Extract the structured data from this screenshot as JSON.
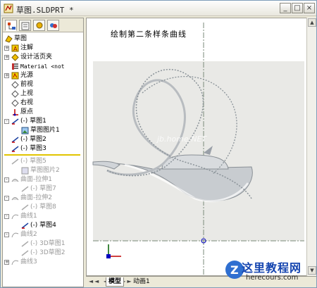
{
  "window": {
    "title": "草图.SLDPRT *",
    "buttons": {
      "minimize": "_",
      "maximize": "□",
      "close": "×"
    }
  },
  "panel_tabs": [
    "feature-manager",
    "property-manager",
    "configuration-manager",
    "display-manager"
  ],
  "tree": {
    "root": "草图",
    "items": [
      {
        "label": "注解",
        "icon": "annotation-icon",
        "greyed": false
      },
      {
        "label": "设计活页夹",
        "icon": "design-binder-icon",
        "greyed": false
      },
      {
        "label": "Material <not",
        "icon": "material-icon",
        "greyed": false
      },
      {
        "label": "光源",
        "icon": "light-icon",
        "greyed": false
      },
      {
        "label": "前视",
        "icon": "plane-icon",
        "greyed": false
      },
      {
        "label": "上视",
        "icon": "plane-icon",
        "greyed": false
      },
      {
        "label": "右视",
        "icon": "plane-icon",
        "greyed": false
      },
      {
        "label": "原点",
        "icon": "origin-icon",
        "greyed": false
      },
      {
        "label": "(-) 草图1",
        "icon": "sketch-icon",
        "greyed": false
      },
      {
        "label": "草图图片1",
        "icon": "sketch-picture-icon",
        "greyed": false
      },
      {
        "label": "(-) 草图2",
        "icon": "sketch-icon",
        "greyed": false
      },
      {
        "label": "(-) 草图3",
        "icon": "sketch-icon",
        "greyed": false
      },
      {
        "label": "(-) 草图5",
        "icon": "sketch-icon",
        "greyed": true
      },
      {
        "label": "草图图片2",
        "icon": "sketch-picture-icon",
        "greyed": true
      },
      {
        "label": "曲面-拉伸1",
        "icon": "surface-icon",
        "greyed": true
      },
      {
        "label": "(-) 草图7",
        "icon": "sketch-icon",
        "greyed": true
      },
      {
        "label": "曲面-拉伸2",
        "icon": "surface-icon",
        "greyed": true
      },
      {
        "label": "(-) 草图8",
        "icon": "sketch-icon",
        "greyed": true
      },
      {
        "label": "曲线1",
        "icon": "curve-icon",
        "greyed": true
      },
      {
        "label": "(-) 草图4",
        "icon": "sketch-icon",
        "greyed": false
      },
      {
        "label": "曲线2",
        "icon": "curve-icon",
        "greyed": true
      },
      {
        "label": "(-) 3D草图1",
        "icon": "sketch3d-icon",
        "greyed": true
      },
      {
        "label": "(-) 3D草图2",
        "icon": "sketch3d-icon",
        "greyed": true
      },
      {
        "label": "曲线3",
        "icon": "curve-icon",
        "greyed": true
      }
    ]
  },
  "viewport": {
    "caption": "绘制第二条样条曲线",
    "watermark": "jb.home.NET"
  },
  "bottom_tabs": {
    "model": "模型",
    "animation": "动画1",
    "nav": "◄◄ ◄ ► ►►"
  },
  "brand": {
    "title": "这里教程网",
    "url": "herecours.com",
    "logo": "Z"
  },
  "colors": {
    "accent_yellow": "#e1c400",
    "frame_blue": "#7f9db9",
    "brand_blue": "#1646b0"
  }
}
